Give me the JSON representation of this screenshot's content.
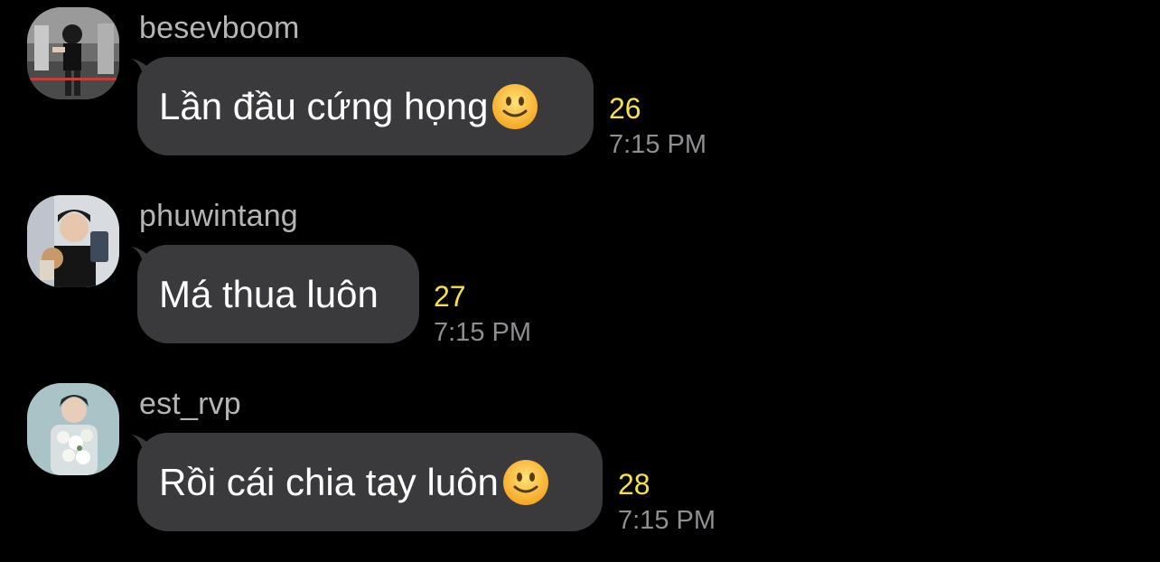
{
  "messages": [
    {
      "username": "besevboom",
      "text": "Lần đầu cứng họng",
      "emoji": "slightly-smiling-face",
      "count": "26",
      "time": "7:15 PM"
    },
    {
      "username": "phuwintang",
      "text": "Má thua luôn",
      "emoji": "",
      "count": "27",
      "time": "7:15 PM"
    },
    {
      "username": "est_rvp",
      "text": "Rồi cái chia tay luôn",
      "emoji": "slightly-smiling-face",
      "count": "28",
      "time": "7:15 PM"
    }
  ],
  "colors": {
    "background": "#000000",
    "bubble": "#3a3a3c",
    "username": "#b5b5b5",
    "count": "#f5e04a",
    "time": "#8e8e93"
  }
}
